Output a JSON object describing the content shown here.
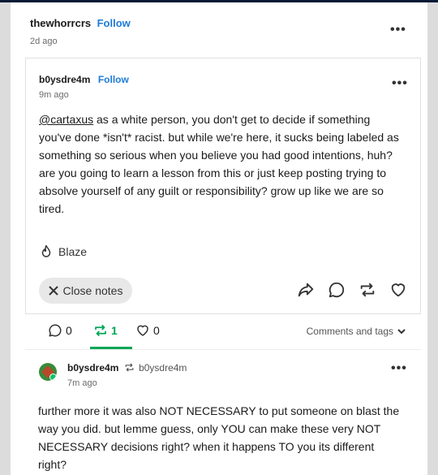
{
  "outer_post": {
    "username": "thewhorrcrs",
    "follow_label": "Follow",
    "time": "2d ago"
  },
  "inner_post": {
    "username": "b0ysdre4m",
    "follow_label": "Follow",
    "time": "9m ago",
    "mention": "@cartaxus",
    "body_rest": " as a white person, you don't get to decide if something you've done *isn't* racist.  but while we're here, it sucks being labeled as something so serious when you believe you had good intentions, huh? are you going to learn a lesson from this or just keep posting trying to absolve yourself of any guilt or responsibility? grow up like we are so tired.",
    "blaze_label": "Blaze",
    "close_notes_label": "Close notes"
  },
  "notes_bar": {
    "comments_count": "0",
    "reblogs_count": "1",
    "likes_count": "0",
    "filter_label": "Comments and tags"
  },
  "reblog_note": {
    "username": "b0ysdre4m",
    "reblogged_from": "b0ysdre4m",
    "time": "7m ago",
    "text": "further more it was also NOT NECESSARY to put someone on blast the way you did.  but lemme guess, only YOU can make these very NOT NECESSARY decisions right? when it happens TO you its different right?"
  },
  "colors": {
    "accent_blue": "#1d7bd8",
    "reblog_green": "#00a656"
  },
  "icons": [
    "more-dots-icon",
    "flame-icon",
    "close-icon",
    "share-icon",
    "reply-icon",
    "reblog-icon",
    "heart-icon",
    "chevron-down-icon"
  ]
}
